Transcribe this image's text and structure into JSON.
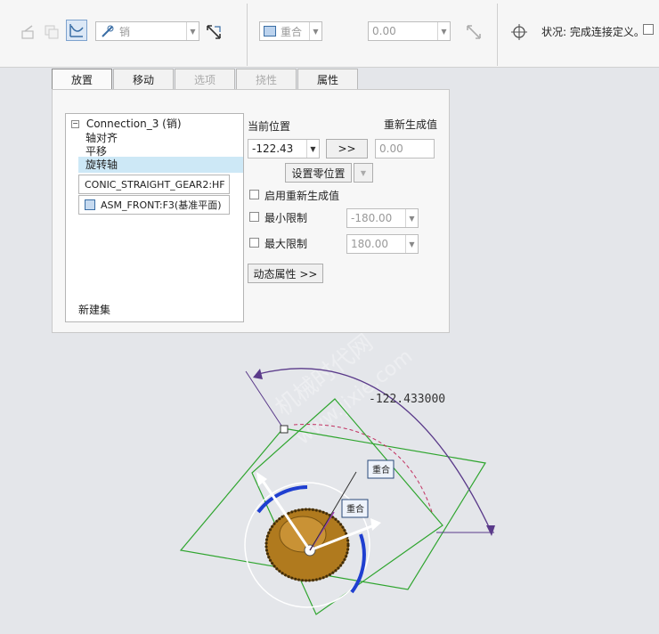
{
  "toolbar": {
    "constraint_type": "销",
    "align_type": "重合",
    "offset_value": "0.00",
    "status": "状况: 完成连接定义。"
  },
  "tabs": [
    {
      "label": "放置"
    },
    {
      "label": "移动"
    },
    {
      "label": "选项"
    },
    {
      "label": "挠性"
    },
    {
      "label": "属性"
    }
  ],
  "tree": {
    "connection": "Connection_3 (销)",
    "items": [
      "轴对齐",
      "平移",
      "旋转轴"
    ],
    "ref1": "CONIC_STRAIGHT_GEAR2:HF",
    "ref2": "ASM_FRONT:F3(基准平面)",
    "new_set": "新建集"
  },
  "settings": {
    "current_position_label": "当前位置",
    "regen_value_label": "重新生成值",
    "current_value": "-122.43",
    "arrow_button": ">>",
    "regen_value": "0.00",
    "set_zero_button": "设置零位置",
    "enable_regen_label": "启用重新生成值",
    "min_limit_label": "最小限制",
    "min_value": "-180.00",
    "max_limit_label": "最大限制",
    "max_value": "180.00",
    "dynamic_props_button": "动态属性 >>"
  },
  "viewport": {
    "dimension": "-122.433000",
    "tag1": "重合",
    "tag2": "重合",
    "watermark1": "机械时代网",
    "watermark2": "www.jixie.com"
  }
}
